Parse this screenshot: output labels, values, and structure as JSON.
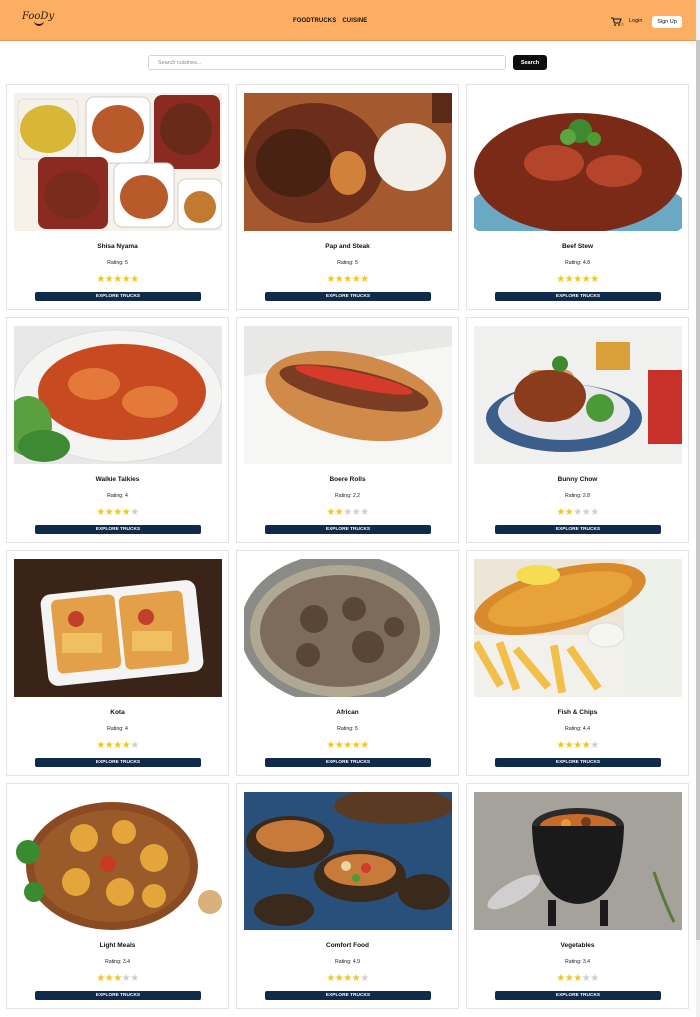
{
  "header": {
    "logo_text": "FooDy",
    "nav": [
      "FOODTRUCKS",
      "CUISINE"
    ],
    "cart_count": "0",
    "login_label": "Login",
    "signup_label": "Sign Up"
  },
  "search": {
    "placeholder": "Search cuisines...",
    "button_label": "Search"
  },
  "cards": [
    {
      "name": "Shisa Nyama",
      "rating_text": "Rating: 5",
      "rating": 5,
      "button": "EXPLORE TRUCKS",
      "palette": [
        "#f6f2ea",
        "#b85a2a",
        "#d8b636",
        "#8a2a20"
      ]
    },
    {
      "name": "Pap and Steak",
      "rating_text": "Rating: 5",
      "rating": 5,
      "button": "EXPLORE TRUCKS",
      "palette": [
        "#a45a2e",
        "#6a2e1a",
        "#f2efe8",
        "#d2813a"
      ]
    },
    {
      "name": "Beef Stew",
      "rating_text": "Rating: 4.8",
      "rating": 5,
      "button": "EXPLORE TRUCKS",
      "palette": [
        "#ffffff",
        "#7a2a16",
        "#b4452a",
        "#6aa8c4"
      ]
    },
    {
      "name": "Walkie Talkies",
      "rating_text": "Rating: 4",
      "rating": 4,
      "button": "EXPLORE TRUCKS",
      "palette": [
        "#f4f4f2",
        "#c84a20",
        "#e37a3a",
        "#5aa040"
      ]
    },
    {
      "name": "Boere Rolls",
      "rating_text": "Rating: 2.2",
      "rating": 2,
      "button": "EXPLORE TRUCKS",
      "palette": [
        "#e8e8e6",
        "#d08a4a",
        "#7a3c22",
        "#d63a2a"
      ]
    },
    {
      "name": "Bunny Chow",
      "rating_text": "Rating: 2.8",
      "rating": 2,
      "button": "EXPLORE TRUCKS",
      "palette": [
        "#f0f0ee",
        "#8a3c1c",
        "#c9a46a",
        "#3b5f8a"
      ]
    },
    {
      "name": "Kota",
      "rating_text": "Rating: 4",
      "rating": 4,
      "button": "EXPLORE TRUCKS",
      "palette": [
        "#3a2418",
        "#e3a048",
        "#c2402a",
        "#f0f0f0"
      ]
    },
    {
      "name": "African",
      "rating_text": "Rating: 5",
      "rating": 5,
      "button": "EXPLORE TRUCKS",
      "palette": [
        "#b0a892",
        "#5a4636",
        "#7d6c5a",
        "#ffffff"
      ]
    },
    {
      "name": "Fish & Chips",
      "rating_text": "Rating: 4.4",
      "rating": 4,
      "button": "EXPLORE TRUCKS",
      "palette": [
        "#ede6d8",
        "#d98a2a",
        "#f2c04a",
        "#eef0ea"
      ]
    },
    {
      "name": "Light Meals",
      "rating_text": "Rating: 3.4",
      "rating": 3,
      "button": "EXPLORE TRUCKS",
      "palette": [
        "#ffffff",
        "#9a5a2a",
        "#e4a53a",
        "#3a8a30"
      ]
    },
    {
      "name": "Comfort Food",
      "rating_text": "Rating: 4.9",
      "rating": 4,
      "button": "EXPLORE TRUCKS",
      "palette": [
        "#28507a",
        "#5a3a22",
        "#c77a3a",
        "#e8d8a0"
      ]
    },
    {
      "name": "Vegetables",
      "rating_text": "Rating: 3.4",
      "rating": 3,
      "button": "EXPLORE TRUCKS",
      "palette": [
        "#8a8680",
        "#1a1a1a",
        "#c86a2a",
        "#d8d4ce"
      ]
    }
  ]
}
